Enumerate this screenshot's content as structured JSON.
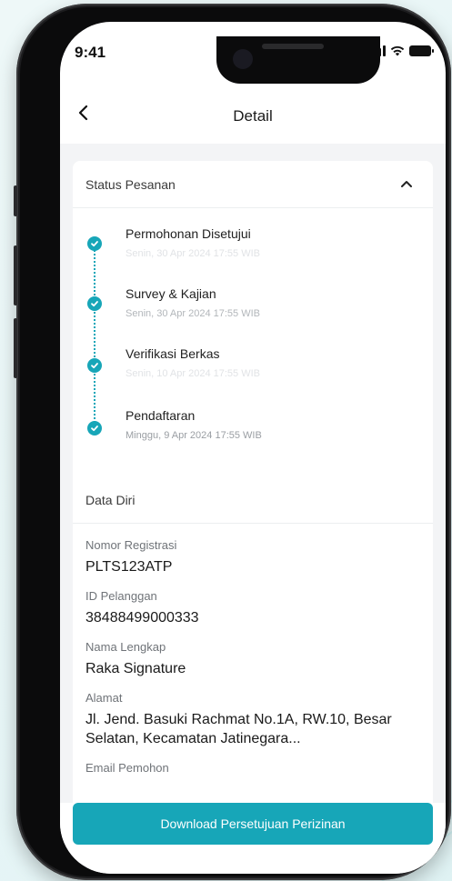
{
  "status_bar": {
    "time": "9:41"
  },
  "header": {
    "title": "Detail"
  },
  "status_card": {
    "title": "Status Pesanan",
    "steps": [
      {
        "title": "Permohonan Disetujui",
        "date": "Senin, 30 Apr 2024 17:55 WIB"
      },
      {
        "title": "Survey & Kajian",
        "date": "Senin, 30 Apr 2024 17:55 WIB"
      },
      {
        "title": "Verifikasi Berkas",
        "date": "Senin, 10 Apr 2024 17:55 WIB"
      },
      {
        "title": "Pendaftaran",
        "date": "Minggu, 9 Apr 2024 17:55 WIB"
      }
    ]
  },
  "data_diri": {
    "title": "Data Diri",
    "fields": [
      {
        "label": "Nomor Registrasi",
        "value": "PLTS123ATP"
      },
      {
        "label": "ID Pelanggan",
        "value": "38488499000333"
      },
      {
        "label": "Nama Lengkap",
        "value": "Raka Signature"
      },
      {
        "label": "Alamat",
        "value": "Jl. Jend. Basuki Rachmat No.1A, RW.10, Besar Selatan, Kecamatan Jatinegara..."
      },
      {
        "label": "Email Pemohon",
        "value": ""
      }
    ]
  },
  "footer": {
    "download_label": "Download Persetujuan Perizinan"
  },
  "colors": {
    "accent": "#17a6b8",
    "background": "#f3f4f6"
  }
}
